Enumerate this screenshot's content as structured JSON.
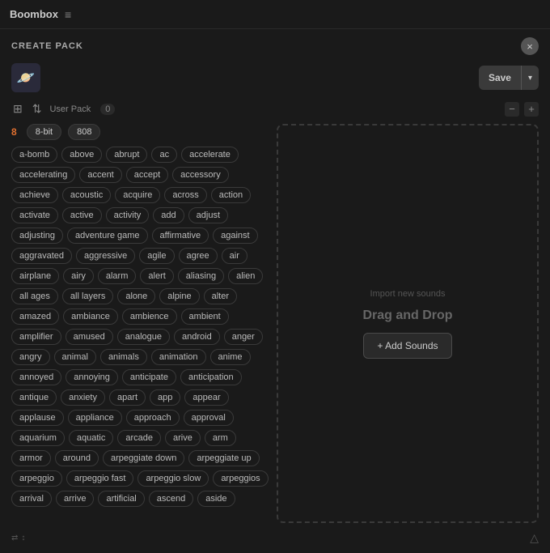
{
  "topbar": {
    "title": "Boombox",
    "menu_icon": "≡"
  },
  "create_pack": {
    "title": "CREATE PACK",
    "close_label": "×",
    "avatar_emoji": "🪐",
    "name_placeholder": "",
    "save_label": "Save",
    "dropdown_icon": "▾"
  },
  "controls": {
    "icon1": "⊞",
    "icon2": "⇅",
    "user_pack_label": "User Pack",
    "user_pack_count": "0",
    "minus": "−",
    "plus": "+"
  },
  "filter_tabs": [
    {
      "label": "8-bit"
    },
    {
      "label": "808"
    }
  ],
  "page_number": "8",
  "tags": [
    "a-bomb",
    "above",
    "abrupt",
    "ac",
    "accelerate",
    "accelerating",
    "accent",
    "accept",
    "accessory",
    "achieve",
    "acoustic",
    "acquire",
    "across",
    "action",
    "activate",
    "active",
    "activity",
    "add",
    "adjust",
    "adjusting",
    "adventure game",
    "affirmative",
    "against",
    "aggravated",
    "aggressive",
    "agile",
    "agree",
    "air",
    "airplane",
    "airy",
    "alarm",
    "alert",
    "aliasing",
    "alien",
    "all ages",
    "all layers",
    "alone",
    "alpine",
    "alter",
    "amazed",
    "ambiance",
    "ambience",
    "ambient",
    "amplifier",
    "amused",
    "analogue",
    "android",
    "anger",
    "angry",
    "animal",
    "animals",
    "animation",
    "anime",
    "annoyed",
    "annoying",
    "anticipate",
    "anticipation",
    "antique",
    "anxiety",
    "apart",
    "app",
    "appear",
    "applause",
    "appliance",
    "approach",
    "approval",
    "aquarium",
    "aquatic",
    "arcade",
    "arive",
    "arm",
    "armor",
    "around",
    "arpeggiate down",
    "arpeggiate up",
    "arpeggio",
    "arpeggio fast",
    "arpeggio slow",
    "arpeggios",
    "arrival",
    "arrive",
    "artificial",
    "ascend",
    "aside"
  ],
  "drop_zone": {
    "hint": "Import new sounds",
    "title": "Drag and Drop",
    "add_button": "+ Add Sounds"
  },
  "bottom": {
    "icon1": "⇄",
    "icon2": "↕",
    "triangle": "△"
  }
}
